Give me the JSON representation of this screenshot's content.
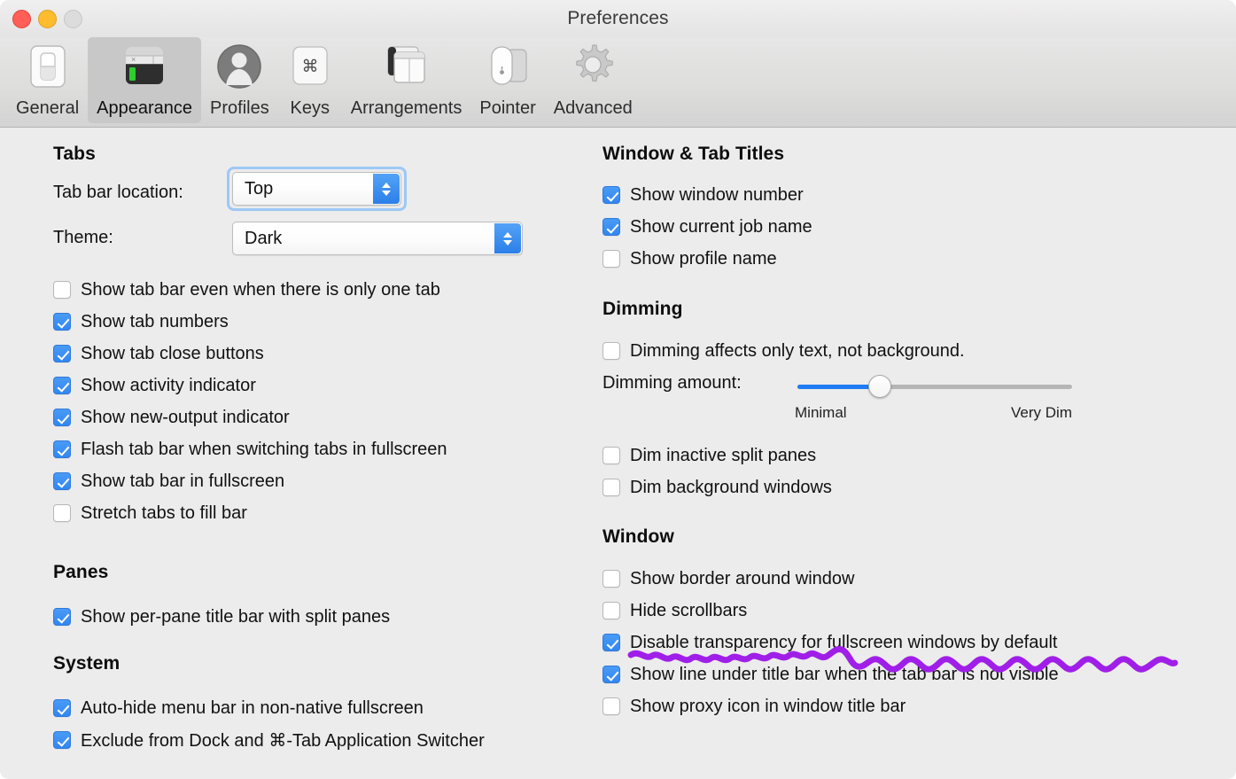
{
  "window": {
    "title": "Preferences",
    "traffic_lights": [
      "close-button",
      "minimize-button",
      "zoom-button"
    ]
  },
  "toolbar": {
    "items": [
      {
        "label": "General",
        "icon": "toggle-switch-icon",
        "selected": false
      },
      {
        "label": "Appearance",
        "icon": "terminal-window-icon",
        "selected": true
      },
      {
        "label": "Profiles",
        "icon": "person-circle-icon",
        "selected": false
      },
      {
        "label": "Keys",
        "icon": "command-key-icon",
        "selected": false
      },
      {
        "label": "Arrangements",
        "icon": "split-windows-icon",
        "selected": false
      },
      {
        "label": "Pointer",
        "icon": "mouse-trackpad-icon",
        "selected": false
      },
      {
        "label": "Advanced",
        "icon": "gear-icon",
        "selected": false
      }
    ]
  },
  "left_column": {
    "tabs": {
      "heading": "Tabs",
      "tab_bar_location": {
        "label": "Tab bar location:",
        "value": "Top",
        "focused": true
      },
      "theme": {
        "label": "Theme:",
        "value": "Dark",
        "focused": false
      },
      "checkboxes": [
        {
          "label": "Show tab bar even when there is only one tab",
          "checked": false
        },
        {
          "label": "Show tab numbers",
          "checked": true
        },
        {
          "label": "Show tab close buttons",
          "checked": true
        },
        {
          "label": "Show activity indicator",
          "checked": true
        },
        {
          "label": "Show new-output indicator",
          "checked": true
        },
        {
          "label": "Flash tab bar when switching tabs in fullscreen",
          "checked": true
        },
        {
          "label": "Show tab bar in fullscreen",
          "checked": true
        },
        {
          "label": "Stretch tabs to fill bar",
          "checked": false
        }
      ]
    },
    "panes": {
      "heading": "Panes",
      "checkboxes": [
        {
          "label": "Show per-pane title bar with split panes",
          "checked": true
        }
      ]
    },
    "system": {
      "heading": "System",
      "checkboxes": [
        {
          "label": "Auto-hide menu bar in non-native fullscreen",
          "checked": true
        },
        {
          "label": "Exclude from Dock and ⌘-Tab Application Switcher",
          "checked": true
        }
      ]
    }
  },
  "right_column": {
    "window_tab_titles": {
      "heading": "Window & Tab Titles",
      "checkboxes": [
        {
          "label": "Show window number",
          "checked": true
        },
        {
          "label": "Show current job name",
          "checked": true
        },
        {
          "label": "Show profile name",
          "checked": false
        }
      ]
    },
    "dimming": {
      "heading": "Dimming",
      "checkboxes_top": [
        {
          "label": "Dimming affects only text, not background.",
          "checked": false
        }
      ],
      "slider": {
        "label": "Dimming amount:",
        "min_label": "Minimal",
        "max_label": "Very Dim",
        "value_percent": 30
      },
      "checkboxes_bottom": [
        {
          "label": "Dim inactive split panes",
          "checked": false
        },
        {
          "label": "Dim background windows",
          "checked": false
        }
      ]
    },
    "window": {
      "heading": "Window",
      "checkboxes": [
        {
          "label": "Show border around window",
          "checked": false
        },
        {
          "label": "Hide scrollbars",
          "checked": false
        },
        {
          "label": "Disable transparency for fullscreen windows by default",
          "checked": true
        },
        {
          "label": "Show line under title bar when the tab bar is not visible",
          "checked": true
        },
        {
          "label": "Show proxy icon in window title bar",
          "checked": false
        }
      ]
    }
  },
  "annotation": {
    "type": "hand-drawn-squiggle-underline",
    "color": "#a01fe8",
    "targets": "Disable transparency for fullscreen windows by default"
  },
  "colors": {
    "accent": "#3286f0",
    "content_background": "#ececec",
    "slider_fill": "#1f7cf2",
    "annotation_purple": "#a01fe8"
  }
}
